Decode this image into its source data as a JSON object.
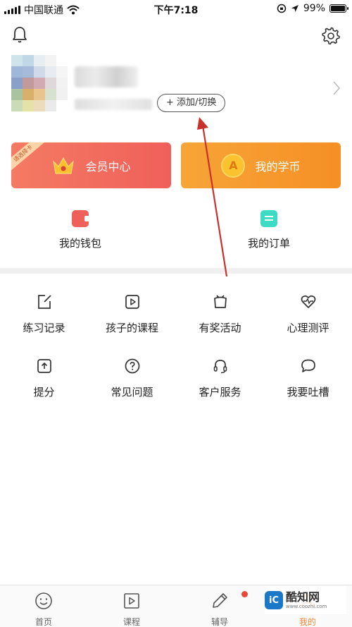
{
  "status_bar": {
    "carrier": "中国联通",
    "time": "下午7:18",
    "battery": "99%",
    "battery_level": 0.99
  },
  "header": {
    "icons": [
      "bell-icon",
      "gear-icon"
    ]
  },
  "profile": {
    "add_switch_label": "+ 添加/切换"
  },
  "cards": {
    "member": {
      "ribbon": "请选择卡",
      "label": "会员中心",
      "icon": "crown-icon"
    },
    "coins": {
      "label": "我的学币",
      "coin_letter": "A"
    }
  },
  "quick": {
    "wallet": "我的钱包",
    "orders": "我的订单"
  },
  "grid": [
    {
      "label": "练习记录",
      "icon": "edit-icon"
    },
    {
      "label": "孩子的课程",
      "icon": "play-icon"
    },
    {
      "label": "有奖活动",
      "icon": "tv-gift-icon"
    },
    {
      "label": "心理测评",
      "icon": "heartbeat-icon"
    },
    {
      "label": "提分",
      "icon": "upload-icon"
    },
    {
      "label": "常见问题",
      "icon": "question-icon"
    },
    {
      "label": "客户服务",
      "icon": "headset-icon"
    },
    {
      "label": "我要吐槽",
      "icon": "chat-icon"
    }
  ],
  "tabbar": {
    "tabs": [
      {
        "label": "首页",
        "icon": "smile-icon"
      },
      {
        "label": "课程",
        "icon": "video-icon"
      },
      {
        "label": "辅导",
        "icon": "pencil-icon"
      },
      {
        "label": "我的",
        "icon": "user-icon"
      }
    ],
    "active": "我的"
  },
  "watermark": {
    "logo": "iC",
    "name": "酷知网",
    "url": "www.coozhi.com"
  },
  "colors": {
    "member_card": "#f0605a",
    "coins_card": "#f58f25",
    "wallet_icon": "#f0605a",
    "orders_icon": "#3ddbc4",
    "annotation_arrow": "#c8312c",
    "active_tab": "#f08b3d"
  }
}
